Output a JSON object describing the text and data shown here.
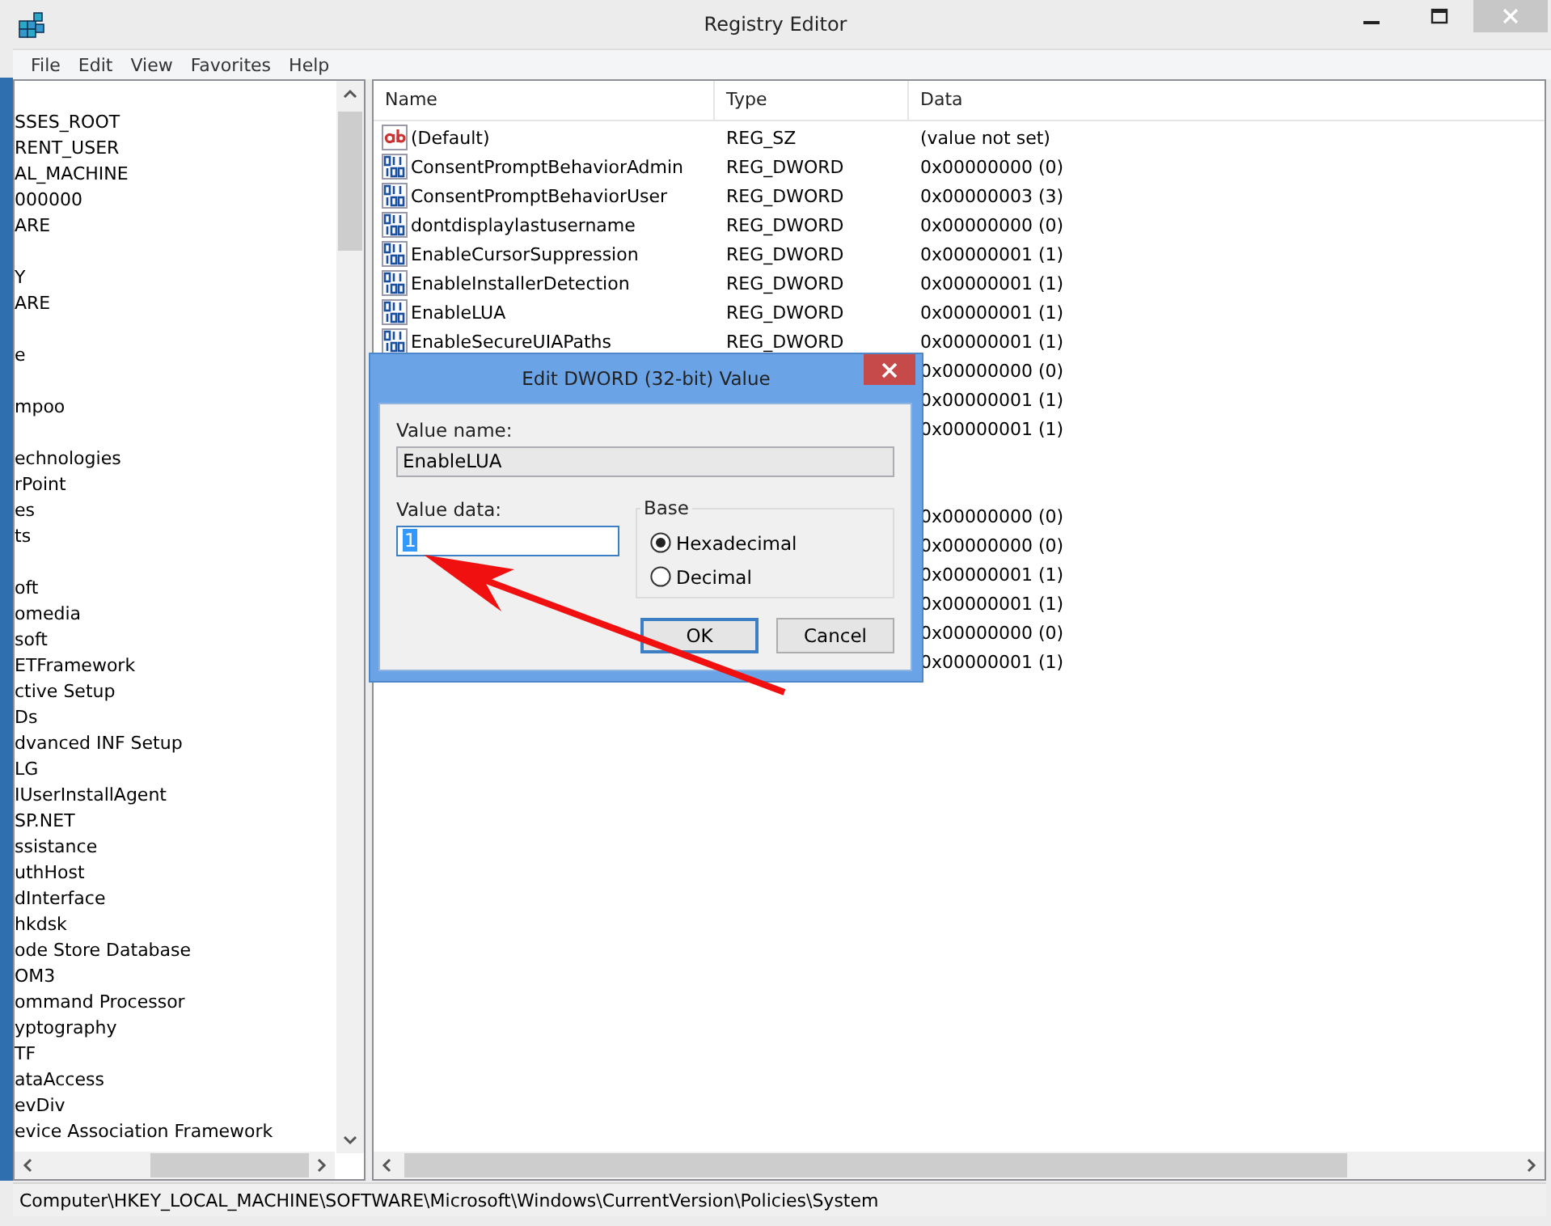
{
  "window": {
    "title": "Registry Editor"
  },
  "menu": [
    "File",
    "Edit",
    "View",
    "Favorites",
    "Help"
  ],
  "tree": {
    "items": [
      {
        "label": "SSES_ROOT",
        "hidden_above": false
      },
      {
        "label": "RENT_USER",
        "hidden_above": false
      },
      {
        "label": "AL_MACHINE",
        "hidden_above": false
      },
      {
        "label": "000000",
        "hidden_above": false
      },
      {
        "label": "ARE",
        "hidden_above": false
      },
      {
        "label": "Y",
        "hidden_above": true
      },
      {
        "label": "ARE",
        "hidden_above": false
      },
      {
        "label": "e",
        "hidden_above": true
      },
      {
        "label": "mpoo",
        "hidden_above": true
      },
      {
        "label": "echnologies",
        "hidden_above": true
      },
      {
        "label": "rPoint",
        "hidden_above": false
      },
      {
        "label": "es",
        "hidden_above": false
      },
      {
        "label": "ts",
        "hidden_above": false
      },
      {
        "label": "oft",
        "hidden_above": true
      },
      {
        "label": "omedia",
        "hidden_above": false
      },
      {
        "label": "soft",
        "hidden_above": false
      },
      {
        "label": "ETFramework",
        "hidden_above": false
      },
      {
        "label": "ctive Setup",
        "hidden_above": false
      },
      {
        "label": "Ds",
        "hidden_above": false
      },
      {
        "label": "dvanced INF Setup",
        "hidden_above": false
      },
      {
        "label": "LG",
        "hidden_above": false
      },
      {
        "label": "IUserInstallAgent",
        "hidden_above": false
      },
      {
        "label": "SP.NET",
        "hidden_above": false
      },
      {
        "label": "ssistance",
        "hidden_above": false
      },
      {
        "label": "uthHost",
        "hidden_above": false
      },
      {
        "label": "dInterface",
        "hidden_above": false
      },
      {
        "label": "hkdsk",
        "hidden_above": false
      },
      {
        "label": "ode Store Database",
        "hidden_above": false
      },
      {
        "label": "OM3",
        "hidden_above": false
      },
      {
        "label": "ommand Processor",
        "hidden_above": false
      },
      {
        "label": "yptography",
        "hidden_above": false
      },
      {
        "label": "TF",
        "hidden_above": false
      },
      {
        "label": "ataAccess",
        "hidden_above": false
      },
      {
        "label": "evDiv",
        "hidden_above": false
      },
      {
        "label": "evice Association Framework",
        "hidden_above": false
      }
    ]
  },
  "values": {
    "columns": [
      "Name",
      "Type",
      "Data"
    ],
    "rows": [
      {
        "kind": "string",
        "name": "(Default)",
        "type": "REG_SZ",
        "data": "(value not set)",
        "gap_before": false
      },
      {
        "kind": "dword",
        "name": "ConsentPromptBehaviorAdmin",
        "type": "REG_DWORD",
        "data": "0x00000000 (0)",
        "gap_before": false
      },
      {
        "kind": "dword",
        "name": "ConsentPromptBehaviorUser",
        "type": "REG_DWORD",
        "data": "0x00000003 (3)",
        "gap_before": false
      },
      {
        "kind": "dword",
        "name": "dontdisplaylastusername",
        "type": "REG_DWORD",
        "data": "0x00000000 (0)",
        "gap_before": false
      },
      {
        "kind": "dword",
        "name": "EnableCursorSuppression",
        "type": "REG_DWORD",
        "data": "0x00000001 (1)",
        "gap_before": false
      },
      {
        "kind": "dword",
        "name": "EnableInstallerDetection",
        "type": "REG_DWORD",
        "data": "0x00000001 (1)",
        "gap_before": false
      },
      {
        "kind": "dword",
        "name": "EnableLUA",
        "type": "REG_DWORD",
        "data": "0x00000001 (1)",
        "gap_before": false
      },
      {
        "kind": "dword",
        "name": "EnableSecureUIAPaths",
        "type": "REG_DWORD",
        "data": "0x00000001 (1)",
        "gap_before": false
      },
      {
        "data": "0x00000000 (0)",
        "gap_before": false
      },
      {
        "data": "0x00000001 (1)",
        "gap_before": false
      },
      {
        "data": "0x00000001 (1)",
        "gap_before": false
      },
      {
        "data": "0x00000000 (0)",
        "gap_before": true
      },
      {
        "data": "0x00000000 (0)",
        "gap_before": false
      },
      {
        "data": "0x00000001 (1)",
        "gap_before": false
      },
      {
        "data": "0x00000001 (1)",
        "gap_before": false
      },
      {
        "data": "0x00000000 (0)",
        "gap_before": false
      },
      {
        "data": "0x00000001 (1)",
        "gap_before": false
      }
    ]
  },
  "dialog": {
    "title": "Edit DWORD (32-bit) Value",
    "value_name_label": "Value name:",
    "value_name": "EnableLUA",
    "value_data_label": "Value data:",
    "value_data": "1",
    "base_label": "Base",
    "base_options": [
      {
        "label": "Hexadecimal",
        "selected": true
      },
      {
        "label": "Decimal",
        "selected": false
      }
    ],
    "buttons": [
      "OK",
      "Cancel"
    ]
  },
  "status_bar": {
    "path": "Computer\\HKEY_LOCAL_MACHINE\\SOFTWARE\\Microsoft\\Windows\\CurrentVersion\\Policies\\System"
  }
}
